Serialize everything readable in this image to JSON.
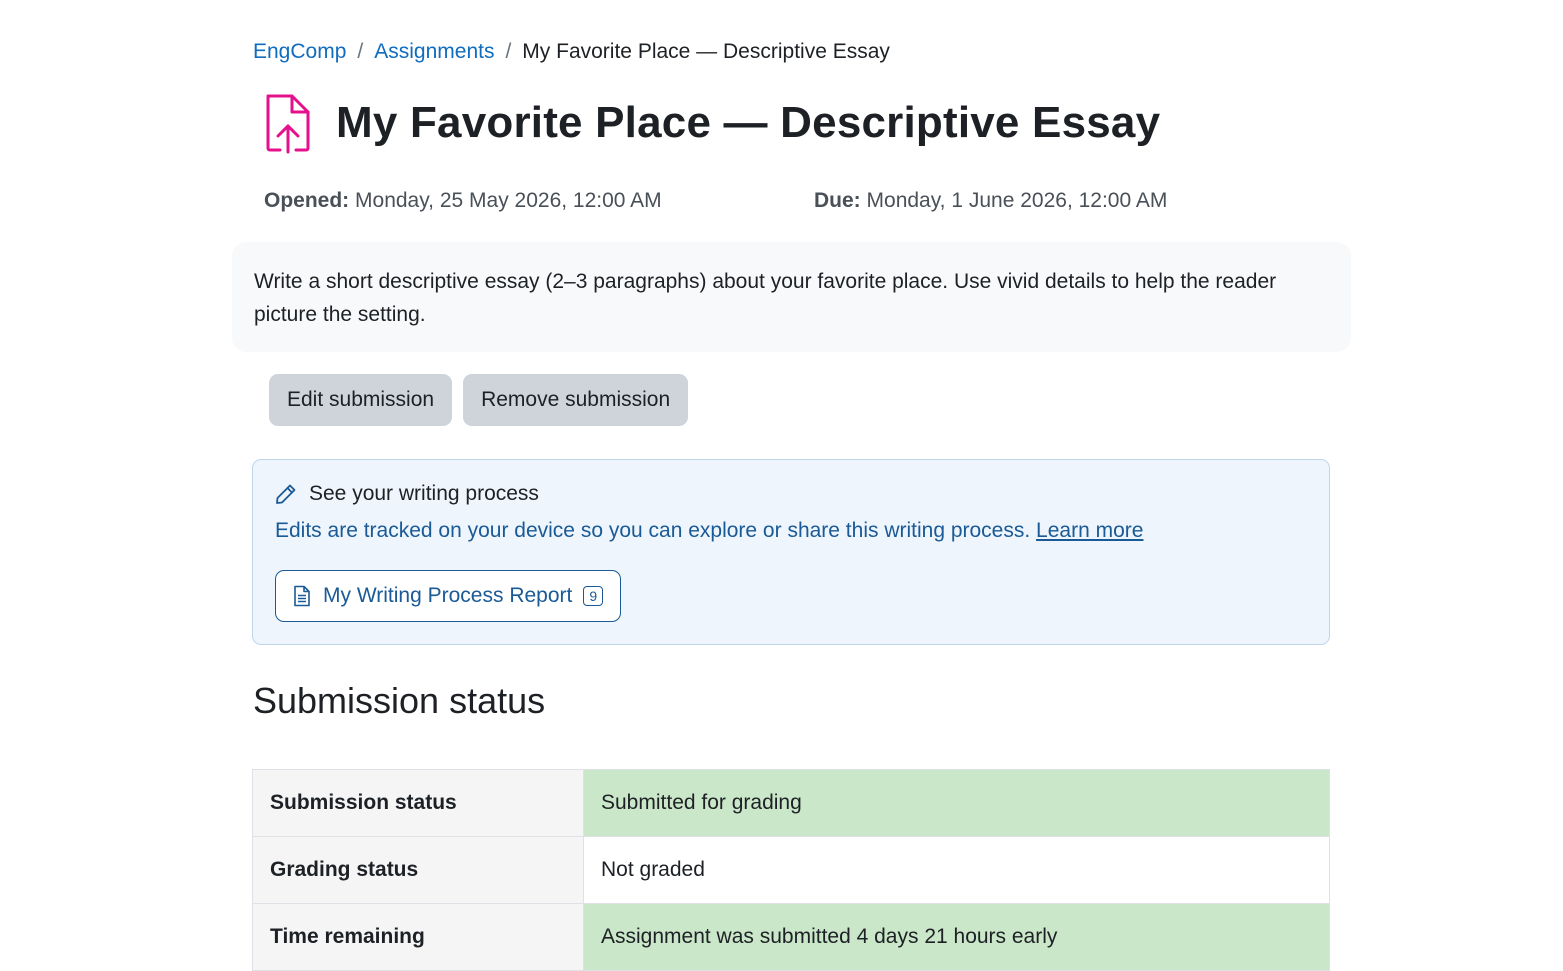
{
  "breadcrumb": {
    "course": "EngComp",
    "section": "Assignments",
    "current": "My Favorite Place — Descriptive Essay",
    "separator": "/"
  },
  "page": {
    "title": "My Favorite Place — Descriptive Essay",
    "icon": "file-upload-icon",
    "accent_color": "#e6108c"
  },
  "dates": {
    "opened_label": "Opened:",
    "opened_value": "Monday, 25 May 2026, 12:00 AM",
    "due_label": "Due:",
    "due_value": "Monday, 1 June 2026, 12:00 AM"
  },
  "intro": {
    "text": "Write a short descriptive essay (2–3 paragraphs) about your favorite place. Use vivid details to help the reader picture the setting."
  },
  "actions": {
    "edit_label": "Edit submission",
    "remove_label": "Remove submission"
  },
  "writing_process": {
    "icon": "pencil-icon",
    "heading": "See your writing process",
    "description": "Edits are tracked on your device so you can explore or share this writing process.",
    "learn_more": "Learn more",
    "report_icon": "document-icon",
    "report_label": "My Writing Process Report",
    "report_count": "9"
  },
  "submission": {
    "section_title": "Submission status",
    "rows": [
      {
        "label": "Submission status",
        "value": "Submitted for grading",
        "status_color": "#cbe7c9"
      },
      {
        "label": "Grading status",
        "value": "Not graded",
        "status_color": "#ffffff"
      },
      {
        "label": "Time remaining",
        "value": "Assignment was submitted 4 days 21 hours early",
        "status_color": "#cbe7c9"
      }
    ]
  }
}
